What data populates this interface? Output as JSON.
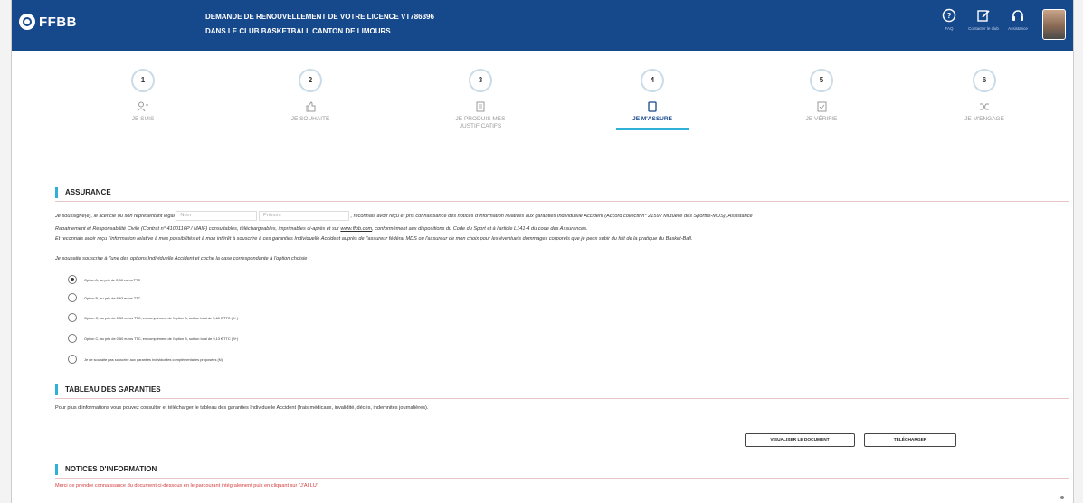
{
  "header": {
    "logo_text": "FFBB",
    "title_line1": "DEMANDE DE RENOUVELLEMENT DE VOTRE LICENCE VT786396",
    "title_line2": "DANS LE CLUB BASKETBALL CANTON DE LIMOURS",
    "tools": [
      {
        "icon": "question-icon",
        "label": "FAQ"
      },
      {
        "icon": "edit-icon",
        "label": "Contacter le club"
      },
      {
        "icon": "headset-icon",
        "label": "Assistance"
      }
    ]
  },
  "stepper": {
    "active_index": 3,
    "steps": [
      {
        "num": "1",
        "icon": "user-plus-icon",
        "label": "JE SUIS"
      },
      {
        "num": "2",
        "icon": "thumbs-up-icon",
        "label": "JE SOUHAITE"
      },
      {
        "num": "3",
        "icon": "document-icon",
        "label_1": "JE PRODUIS MES",
        "label_2": "JUSTIFICATIFS"
      },
      {
        "num": "4",
        "icon": "tablet-icon",
        "label": "JE M'ASSURE"
      },
      {
        "num": "5",
        "icon": "check-box-icon",
        "label": "JE VÉRIFIE"
      },
      {
        "num": "6",
        "icon": "shuffle-icon",
        "label": "JE M'ENGAGE"
      }
    ]
  },
  "assurance": {
    "heading": "ASSURANCE",
    "p1_a": "Je soussigné(e), le licencié ou son représentant légal",
    "nom_placeholder": "Nom",
    "prenom_placeholder": "Prénom",
    "p1_b": ", reconnais avoir reçu et pris connaissance des notices d'information relatives aux garanties Individuelle Accident (Accord collectif n° 2159 / Mutuelle des Sportifs-MDS), Assistance",
    "p2_a": "Rapatriement et Responsabilité Civile (Contrat n° 4100116P / MAIF) consultables, téléchargeables, imprimables ci-après et sur ",
    "p2_link": "www.ffbb.com",
    "p2_b": ", conformément aux dispositions du Code du Sport et à l'article L141-4 du code des Assurances.",
    "p3": "Et reconnais avoir reçu l'information relative à mes possibilités et à mon intérêt à souscrire à ces garanties Individuelle Accident auprès de l'assureur fédéral MDS ou l'assureur de mon choix pour les éventuels dommages corporels que je peux subir du fait de la pratique du Basket-Ball.",
    "question": "Je souhaite souscrire à l'une des options Individuelle Accident et coche la case correspondante à l'option choisie :",
    "options": [
      "Option A, au prix de 2,98 euros TTC",
      "Option B, au prix de 8,63 euros TTC",
      "Option C, au prix de 0,50 euros TTC, en complément de l'option A, soit un total de 3,48 € TTC (A+)",
      "Option C, au prix de 0,50 euros TTC, en complément de l'option B, soit un total de 9,13 € TTC (B+)",
      "Je ne souhaite pas souscrire aux garanties Individuelles complémentaires proposées (N)"
    ],
    "selected_index": 0
  },
  "garanties": {
    "heading": "TABLEAU DES GARANTIES",
    "text": "Pour plus d'informations vous pouvez consulter et télécharger le tableau des garanties Individuelle Accident (frais médicaux, invalidité, décès, indemnités journalières).",
    "btn_view": "VISUALISER LE DOCUMENT",
    "btn_download": "TÉLÉCHARGER"
  },
  "notices": {
    "heading": "NOTICES D'INFORMATION",
    "text": "Merci de prendre connaissance du document ci-dessous en le parcourant intégralement puis en cliquant sur \"J'AI LU\""
  }
}
